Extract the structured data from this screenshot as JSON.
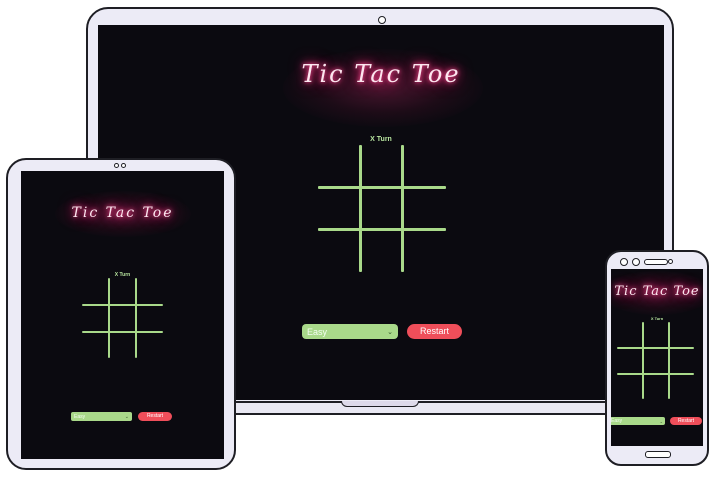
{
  "app": {
    "title": "Tic Tac Toe",
    "turn_label": "X Turn",
    "difficulty_selected": "Easy",
    "restart_label": "Restart"
  },
  "icons": {
    "select_chevron": "chevron-down-icon"
  },
  "colors": {
    "screen_background": "#0b0a10",
    "neon_title": "#ff2e7e",
    "grid_lines": "#a9d98a",
    "restart_button": "#ef4e5a",
    "device_frame": "#ecebf6"
  }
}
